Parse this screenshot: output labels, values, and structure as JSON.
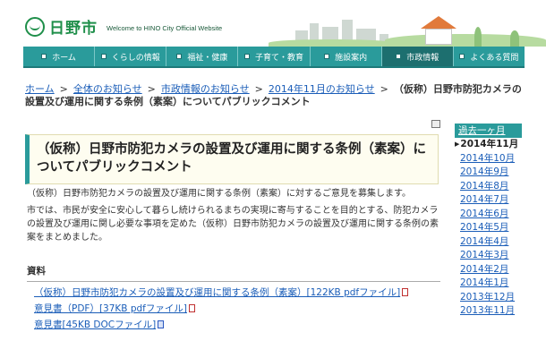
{
  "header": {
    "logo_name": "日野市",
    "logo_subtitle": "Welcome to HINO City Official Website"
  },
  "nav": {
    "items": [
      {
        "label": "ホーム"
      },
      {
        "label": "くらしの情報"
      },
      {
        "label": "福祉・健康"
      },
      {
        "label": "子育て・教育"
      },
      {
        "label": "施設案内"
      },
      {
        "label": "市政情報"
      },
      {
        "label": "よくある質問"
      }
    ],
    "active_index": 5
  },
  "breadcrumb": {
    "items": [
      "ホーム",
      "全体のお知らせ",
      "市政情報のお知らせ",
      "2014年11月のお知らせ"
    ],
    "separator": ">",
    "current": "（仮称）日野市防犯カメラの設置及び運用に関する条例（素案）についてパブリックコメント"
  },
  "page": {
    "title": "（仮称）日野市防犯カメラの設置及び運用に関する条例（素案）についてパブリックコメント",
    "paragraph1": "（仮称）日野市防犯カメラの設置及び運用に関する条例（素案）に対するご意見を募集します。",
    "paragraph2": "市では、市民が安全に安心して暮らし続けられるまちの実現に寄与することを目的とする、防犯カメラの設置及び運用に関し必要な事項を定めた（仮称）日野市防犯カメラの設置及び運用に関する条例の素案をまとめました。",
    "section_heading": "資料"
  },
  "documents": [
    {
      "label": "（仮称）日野市防犯カメラの設置及び運用に関する条例（素案）[122KB pdfファイル]",
      "icon": "pdf-icon"
    },
    {
      "label": "意見書（PDF）[37KB pdfファイル]",
      "icon": "pdf-icon"
    },
    {
      "label": "意見書[45KB DOCファイル]",
      "icon": "doc-icon"
    }
  ],
  "sidebar": {
    "heading": "過去一ヶ月",
    "months": [
      "2014年11月",
      "2014年10月",
      "2014年9月",
      "2014年8月",
      "2014年7月",
      "2014年6月",
      "2014年5月",
      "2014年4月",
      "2014年3月",
      "2014年2月",
      "2014年1月",
      "2013年12月",
      "2013年11月"
    ],
    "current_index": 0
  },
  "colors": {
    "nav_teal": "#2a9b9b",
    "nav_active": "#1d6f6f",
    "link_blue": "#1a5db8",
    "logo_green": "#1f8f4a"
  }
}
